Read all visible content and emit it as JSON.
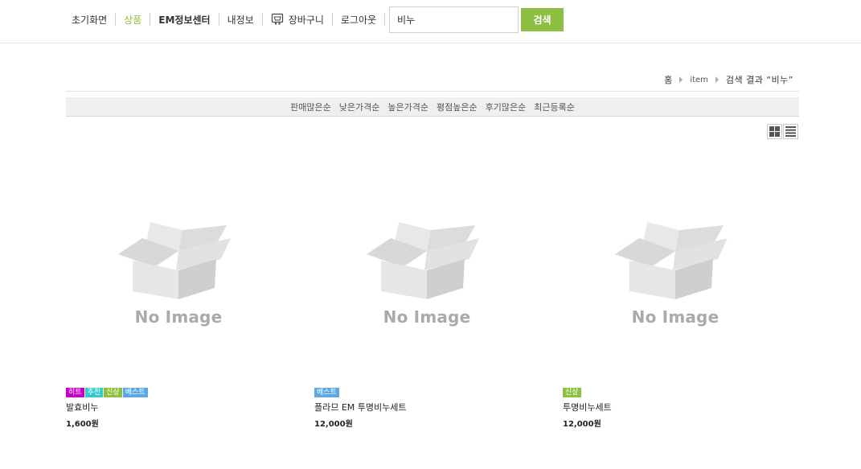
{
  "nav": {
    "items": [
      {
        "label": "초기화면"
      },
      {
        "label": "상품"
      },
      {
        "label": "EM정보센터"
      },
      {
        "label": "내정보"
      },
      {
        "label": "장바구니"
      },
      {
        "label": "로그아웃"
      }
    ],
    "active_color": "#8dc042"
  },
  "search": {
    "value": "비누",
    "button_label": "검색",
    "button_color": "#8dc042"
  },
  "breadcrumb": {
    "home": "홈",
    "item": "item",
    "current": "검색 결과 “비누”"
  },
  "sort": {
    "options": [
      "판매많은순",
      "낮은가격순",
      "높은가격순",
      "평점높은순",
      "후기많은순",
      "최근등록순"
    ]
  },
  "view": {
    "grid_icon": "grid-view-icon",
    "list_icon": "list-view-icon"
  },
  "products": [
    {
      "image_text": "No Image",
      "badges": [
        {
          "label": "히트",
          "color": "#cc00cc"
        },
        {
          "label": "추천",
          "color": "#33cccc"
        },
        {
          "label": "신상",
          "color": "#8dc042"
        },
        {
          "label": "베스트",
          "color": "#5aa9e6"
        }
      ],
      "name": "발효비누",
      "price": "1,600원"
    },
    {
      "image_text": "No Image",
      "badges": [
        {
          "label": "베스트",
          "color": "#5aa9e6"
        }
      ],
      "name": "플라므 EM 투명비누세트",
      "price": "12,000원"
    },
    {
      "image_text": "No Image",
      "badges": [
        {
          "label": "신상",
          "color": "#8dc042"
        }
      ],
      "name": "투명비누세트",
      "price": "12,000원"
    }
  ]
}
